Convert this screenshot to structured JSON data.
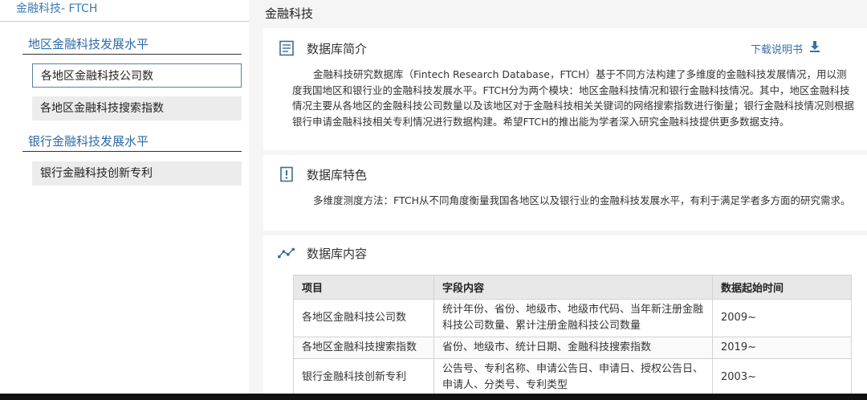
{
  "sidebar": {
    "title": "金融科技- FTCH",
    "sections": [
      {
        "label": "地区金融科技发展水平"
      },
      {
        "label": "银行金融科技发展水平"
      }
    ],
    "items": [
      {
        "label": "各地区金融科技公司数"
      },
      {
        "label": "各地区金融科技搜索指数"
      },
      {
        "label": "银行金融科技创新专利"
      }
    ]
  },
  "main": {
    "title": "金融科技",
    "intro": {
      "heading": "数据库简介",
      "download": "下载说明书",
      "text": "金融科技研究数据库（Fintech Research Database，FTCH）基于不同方法构建了多维度的金融科技发展情况，用以测度我国地区和银行业的金融科技发展水平。FTCH分为两个模块：地区金融科技情况和银行金融科技情况。其中，地区金融科技情况主要从各地区的金融科技公司数量以及该地区对于金融科技相关关键词的网络搜索指数进行衡量；银行金融科技情况则根据银行申请金融科技相关专利情况进行数据构建。希望FTCH的推出能为学者深入研究金融科技提供更多数据支持。"
    },
    "features": {
      "heading": "数据库特色",
      "text": "多维度测度方法：FTCH从不同角度衡量我国各地区以及银行业的金融科技发展水平，有利于满足学者多方面的研究需求。"
    },
    "content": {
      "heading": "数据库内容",
      "columns": [
        "项目",
        "字段内容",
        "数据起始时间"
      ],
      "rows": [
        [
          "各地区金融科技公司数",
          "统计年份、省份、地级市、地级市代码、当年新注册金融科技公司数量、累计注册金融科技公司数量",
          "2009~"
        ],
        [
          "各地区金融科技搜索指数",
          "省份、地级市、统计日期、金融科技搜索指数",
          "2019~"
        ],
        [
          "银行金融科技创新专利",
          "公告号、专利名称、申请公告日、申请日、授权公告日、申请人、分类号、专利类型",
          "2003~"
        ]
      ]
    }
  }
}
